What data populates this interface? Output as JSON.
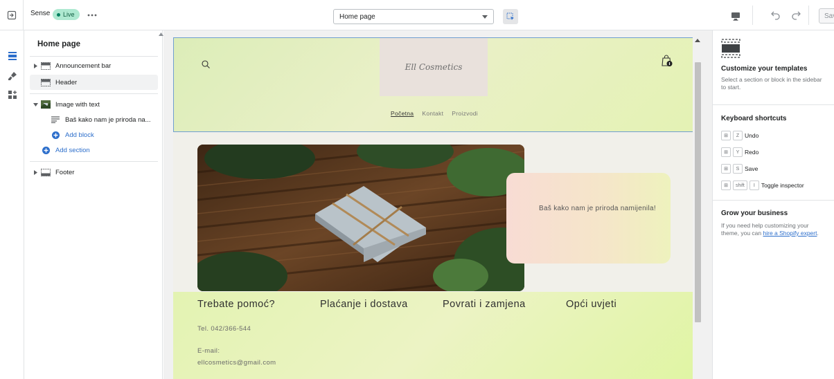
{
  "topbar": {
    "theme_name": "Sense",
    "live_label": "Live",
    "page_select_value": "Home page",
    "save_label": "Save"
  },
  "sidebar": {
    "title": "Home page",
    "items": [
      {
        "label": "Announcement bar"
      },
      {
        "label": "Header"
      },
      {
        "label": "Image with text"
      },
      {
        "label": "Baš kako nam je priroda na..."
      },
      {
        "label": "Add block"
      },
      {
        "label": "Add section"
      },
      {
        "label": "Footer"
      }
    ]
  },
  "preview": {
    "logo_text": "Ell Cosmetics",
    "nav": [
      "Početna",
      "Kontakt",
      "Proizvodi"
    ],
    "card_text": "Baš kako nam je priroda namijenila!",
    "footer": {
      "headings": [
        "Trebate pomoć?",
        "Plaćanje i dostava",
        "Povrati i zamjena",
        "Opći uvjeti"
      ],
      "phone": "Tel. 042/366-544",
      "email_label": "E-mail:",
      "email": "ellcosmetics@gmail.com"
    }
  },
  "right_panel": {
    "customize_title": "Customize your templates",
    "customize_text": "Select a section or block in the sidebar to start.",
    "shortcuts_title": "Keyboard shortcuts",
    "shortcuts": [
      {
        "keys": [
          "Z"
        ],
        "label": "Undo"
      },
      {
        "keys": [
          "Y"
        ],
        "label": "Redo"
      },
      {
        "keys": [
          "S"
        ],
        "label": "Save"
      },
      {
        "keys": [
          "shift",
          "I"
        ],
        "label": "Toggle inspector"
      }
    ],
    "grow_title": "Grow your business",
    "grow_text": "If you need help customizing your theme, you can",
    "grow_link": "hire a Shopify expert",
    "grow_end": "."
  },
  "colors": {
    "accent_blue": "#2c6ecb",
    "live_green": "#aee9d1",
    "header_bg": "#dcedb8",
    "footer_bg": "#e3f3b2"
  }
}
